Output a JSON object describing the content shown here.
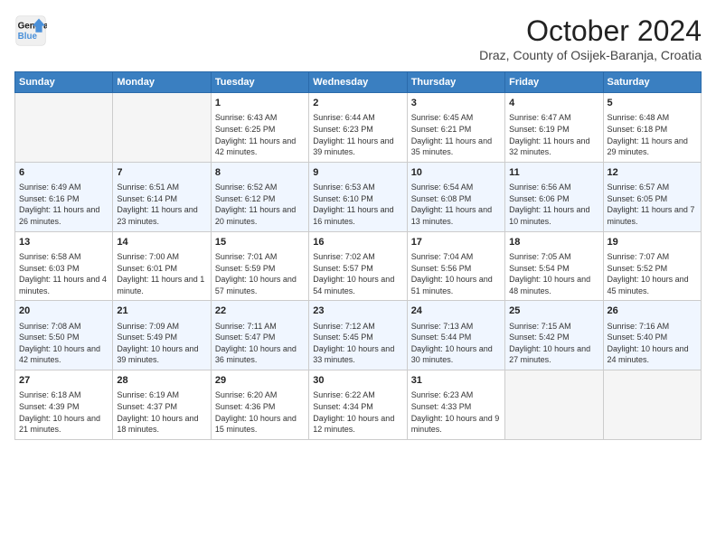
{
  "header": {
    "logo_line1": "General",
    "logo_line2": "Blue",
    "month": "October 2024",
    "location": "Draz, County of Osijek-Baranja, Croatia"
  },
  "weekdays": [
    "Sunday",
    "Monday",
    "Tuesday",
    "Wednesday",
    "Thursday",
    "Friday",
    "Saturday"
  ],
  "weeks": [
    [
      {
        "day": "",
        "sunrise": "",
        "sunset": "",
        "daylight": "",
        "empty": true
      },
      {
        "day": "",
        "sunrise": "",
        "sunset": "",
        "daylight": "",
        "empty": true
      },
      {
        "day": "1",
        "sunrise": "Sunrise: 6:43 AM",
        "sunset": "Sunset: 6:25 PM",
        "daylight": "Daylight: 11 hours and 42 minutes."
      },
      {
        "day": "2",
        "sunrise": "Sunrise: 6:44 AM",
        "sunset": "Sunset: 6:23 PM",
        "daylight": "Daylight: 11 hours and 39 minutes."
      },
      {
        "day": "3",
        "sunrise": "Sunrise: 6:45 AM",
        "sunset": "Sunset: 6:21 PM",
        "daylight": "Daylight: 11 hours and 35 minutes."
      },
      {
        "day": "4",
        "sunrise": "Sunrise: 6:47 AM",
        "sunset": "Sunset: 6:19 PM",
        "daylight": "Daylight: 11 hours and 32 minutes."
      },
      {
        "day": "5",
        "sunrise": "Sunrise: 6:48 AM",
        "sunset": "Sunset: 6:18 PM",
        "daylight": "Daylight: 11 hours and 29 minutes."
      }
    ],
    [
      {
        "day": "6",
        "sunrise": "Sunrise: 6:49 AM",
        "sunset": "Sunset: 6:16 PM",
        "daylight": "Daylight: 11 hours and 26 minutes."
      },
      {
        "day": "7",
        "sunrise": "Sunrise: 6:51 AM",
        "sunset": "Sunset: 6:14 PM",
        "daylight": "Daylight: 11 hours and 23 minutes."
      },
      {
        "day": "8",
        "sunrise": "Sunrise: 6:52 AM",
        "sunset": "Sunset: 6:12 PM",
        "daylight": "Daylight: 11 hours and 20 minutes."
      },
      {
        "day": "9",
        "sunrise": "Sunrise: 6:53 AM",
        "sunset": "Sunset: 6:10 PM",
        "daylight": "Daylight: 11 hours and 16 minutes."
      },
      {
        "day": "10",
        "sunrise": "Sunrise: 6:54 AM",
        "sunset": "Sunset: 6:08 PM",
        "daylight": "Daylight: 11 hours and 13 minutes."
      },
      {
        "day": "11",
        "sunrise": "Sunrise: 6:56 AM",
        "sunset": "Sunset: 6:06 PM",
        "daylight": "Daylight: 11 hours and 10 minutes."
      },
      {
        "day": "12",
        "sunrise": "Sunrise: 6:57 AM",
        "sunset": "Sunset: 6:05 PM",
        "daylight": "Daylight: 11 hours and 7 minutes."
      }
    ],
    [
      {
        "day": "13",
        "sunrise": "Sunrise: 6:58 AM",
        "sunset": "Sunset: 6:03 PM",
        "daylight": "Daylight: 11 hours and 4 minutes."
      },
      {
        "day": "14",
        "sunrise": "Sunrise: 7:00 AM",
        "sunset": "Sunset: 6:01 PM",
        "daylight": "Daylight: 11 hours and 1 minute."
      },
      {
        "day": "15",
        "sunrise": "Sunrise: 7:01 AM",
        "sunset": "Sunset: 5:59 PM",
        "daylight": "Daylight: 10 hours and 57 minutes."
      },
      {
        "day": "16",
        "sunrise": "Sunrise: 7:02 AM",
        "sunset": "Sunset: 5:57 PM",
        "daylight": "Daylight: 10 hours and 54 minutes."
      },
      {
        "day": "17",
        "sunrise": "Sunrise: 7:04 AM",
        "sunset": "Sunset: 5:56 PM",
        "daylight": "Daylight: 10 hours and 51 minutes."
      },
      {
        "day": "18",
        "sunrise": "Sunrise: 7:05 AM",
        "sunset": "Sunset: 5:54 PM",
        "daylight": "Daylight: 10 hours and 48 minutes."
      },
      {
        "day": "19",
        "sunrise": "Sunrise: 7:07 AM",
        "sunset": "Sunset: 5:52 PM",
        "daylight": "Daylight: 10 hours and 45 minutes."
      }
    ],
    [
      {
        "day": "20",
        "sunrise": "Sunrise: 7:08 AM",
        "sunset": "Sunset: 5:50 PM",
        "daylight": "Daylight: 10 hours and 42 minutes."
      },
      {
        "day": "21",
        "sunrise": "Sunrise: 7:09 AM",
        "sunset": "Sunset: 5:49 PM",
        "daylight": "Daylight: 10 hours and 39 minutes."
      },
      {
        "day": "22",
        "sunrise": "Sunrise: 7:11 AM",
        "sunset": "Sunset: 5:47 PM",
        "daylight": "Daylight: 10 hours and 36 minutes."
      },
      {
        "day": "23",
        "sunrise": "Sunrise: 7:12 AM",
        "sunset": "Sunset: 5:45 PM",
        "daylight": "Daylight: 10 hours and 33 minutes."
      },
      {
        "day": "24",
        "sunrise": "Sunrise: 7:13 AM",
        "sunset": "Sunset: 5:44 PM",
        "daylight": "Daylight: 10 hours and 30 minutes."
      },
      {
        "day": "25",
        "sunrise": "Sunrise: 7:15 AM",
        "sunset": "Sunset: 5:42 PM",
        "daylight": "Daylight: 10 hours and 27 minutes."
      },
      {
        "day": "26",
        "sunrise": "Sunrise: 7:16 AM",
        "sunset": "Sunset: 5:40 PM",
        "daylight": "Daylight: 10 hours and 24 minutes."
      }
    ],
    [
      {
        "day": "27",
        "sunrise": "Sunrise: 6:18 AM",
        "sunset": "Sunset: 4:39 PM",
        "daylight": "Daylight: 10 hours and 21 minutes."
      },
      {
        "day": "28",
        "sunrise": "Sunrise: 6:19 AM",
        "sunset": "Sunset: 4:37 PM",
        "daylight": "Daylight: 10 hours and 18 minutes."
      },
      {
        "day": "29",
        "sunrise": "Sunrise: 6:20 AM",
        "sunset": "Sunset: 4:36 PM",
        "daylight": "Daylight: 10 hours and 15 minutes."
      },
      {
        "day": "30",
        "sunrise": "Sunrise: 6:22 AM",
        "sunset": "Sunset: 4:34 PM",
        "daylight": "Daylight: 10 hours and 12 minutes."
      },
      {
        "day": "31",
        "sunrise": "Sunrise: 6:23 AM",
        "sunset": "Sunset: 4:33 PM",
        "daylight": "Daylight: 10 hours and 9 minutes."
      },
      {
        "day": "",
        "sunrise": "",
        "sunset": "",
        "daylight": "",
        "empty": true
      },
      {
        "day": "",
        "sunrise": "",
        "sunset": "",
        "daylight": "",
        "empty": true
      }
    ]
  ]
}
